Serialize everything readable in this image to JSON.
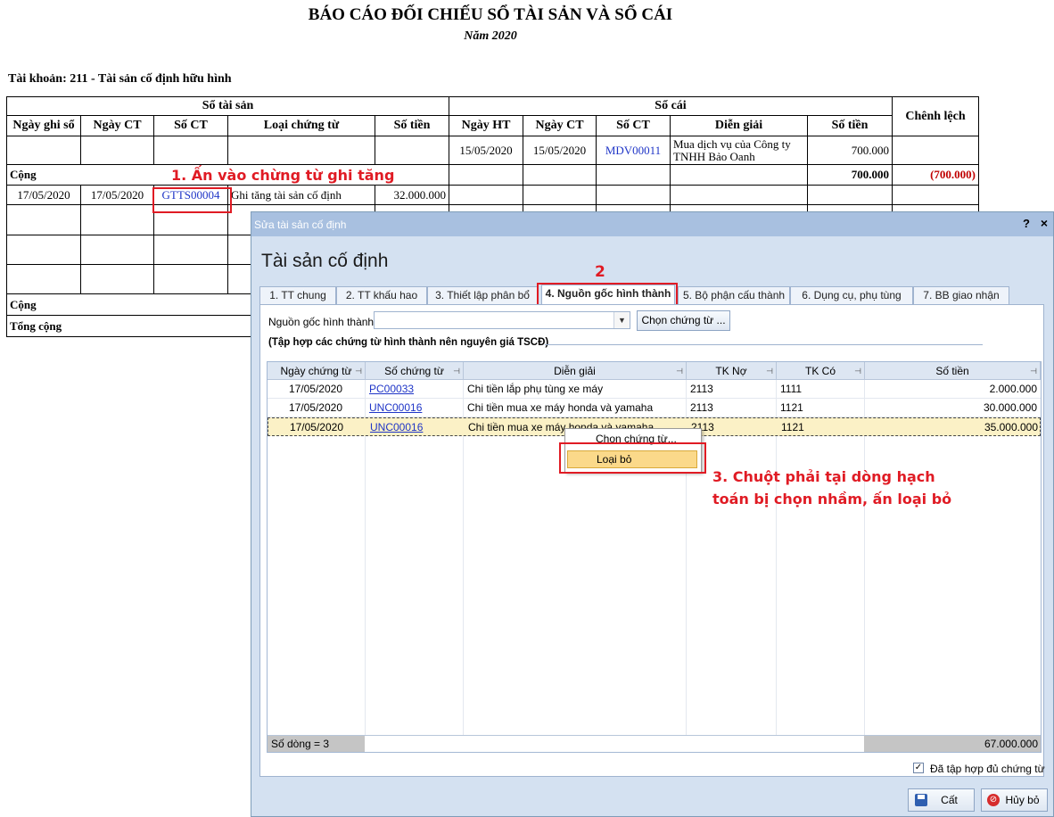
{
  "report": {
    "title": "BÁO CÁO ĐỐI CHIẾU SỔ TÀI SẢN VÀ SỔ CÁI",
    "subtitle": "Năm 2020",
    "account": "Tài khoản: 211 - Tài sản cố định hữu hình",
    "group_asset": "Sổ tài sản",
    "group_ledger": "Sổ cái",
    "col_diff": "Chênh lệch",
    "asset_cols": [
      "Ngày ghi sổ",
      "Ngày CT",
      "Số CT",
      "Loại chứng từ",
      "Số tiền"
    ],
    "ledger_cols": [
      "Ngày HT",
      "Ngày CT",
      "Số CT",
      "Diễn giải",
      "Số tiền"
    ],
    "ledger_row": {
      "date_ht": "15/05/2020",
      "date_ct": "15/05/2020",
      "no": "MDV00011",
      "desc": "Mua dịch vụ của Công ty TNHH Bảo Oanh",
      "amount": "700.000"
    },
    "sum_label": "Cộng",
    "sum_ledger_amount": "700.000",
    "sum_diff": "(700.000)",
    "asset_row": {
      "date": "17/05/2020",
      "date_ct": "17/05/2020",
      "no": "GTTS00004",
      "type": "Ghi tăng tài sản cố định",
      "amount": "32.000.000"
    },
    "sum2_label": "Cộng",
    "total_label": "Tổng cộng"
  },
  "annotations": {
    "step1": "1. Ấn vào chừng từ ghi tăng",
    "step2": "2",
    "step3_line1": "3. Chuột phải tại dòng hạch",
    "step3_line2": "toán bị chọn nhầm, ấn loại bỏ"
  },
  "dialog": {
    "window_title": "Sửa tài sản cố định",
    "help_label": "?",
    "close_label": "×",
    "heading": "Tài sản cố định",
    "tabs": [
      "1. TT chung",
      "2. TT khấu hao",
      "3. Thiết lập phân bổ",
      "4. Nguồn gốc hình thành",
      "5. Bộ phận cấu thành",
      "6. Dụng cụ, phụ tùng",
      "7. BB giao nhận"
    ],
    "source_label": "Nguồn gốc hình thành",
    "source_value": "",
    "choose_doc_button": "Chọn chứng từ ...",
    "section_title": "(Tập hợp các chứng từ hình thành nên nguyên giá TSCĐ)",
    "grid": {
      "columns": [
        "Ngày chứng từ",
        "Số chứng từ",
        "Diễn giải",
        "TK Nợ",
        "TK Có",
        "Số tiền"
      ],
      "rows": [
        {
          "date": "17/05/2020",
          "no": "PC00033",
          "desc": "Chi tiền lắp phụ tùng xe máy",
          "debit": "2113",
          "credit": "1111",
          "amount": "2.000.000"
        },
        {
          "date": "17/05/2020",
          "no": "UNC00016",
          "desc": "Chi tiền mua xe máy honda và yamaha",
          "debit": "2113",
          "credit": "1121",
          "amount": "30.000.000"
        },
        {
          "date": "17/05/2020",
          "no": "UNC00016",
          "desc": "Chi tiền mua xe máy honda và yamaha",
          "debit": "2113",
          "credit": "1121",
          "amount": "35.000.000"
        }
      ],
      "footer_count": "Số dòng = 3",
      "footer_total": "67.000.000"
    },
    "context_menu": {
      "item1": "Chọn chứng từ...",
      "item2": "Loại bỏ"
    },
    "checkbox_label": "Đã tập hợp đủ chứng từ",
    "checkbox_checked": true,
    "save_button": "Cất",
    "cancel_button": "Hủy bỏ"
  }
}
